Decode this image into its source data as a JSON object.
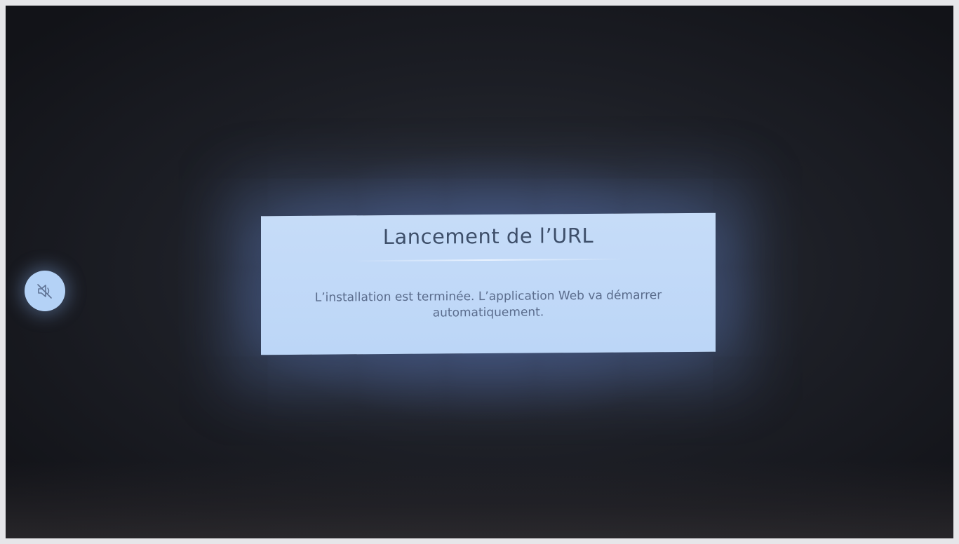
{
  "dialog": {
    "title": "Lancement de l’URL",
    "message": "L’installation est terminée. L’application Web va démarrer automatiquement."
  },
  "indicators": {
    "mute_icon": "speaker-muted-icon"
  },
  "colors": {
    "dialog_background": "#bcd6f7",
    "dialog_title": "#3e4f6a",
    "dialog_message": "#5a6c8c",
    "screen_background": "#1c1e25"
  }
}
